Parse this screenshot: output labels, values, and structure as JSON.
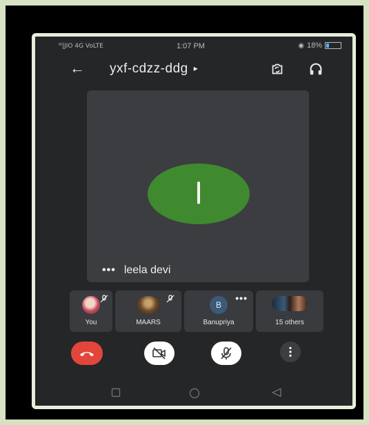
{
  "status": {
    "carrier": "ᴵᴵᴵ|JIO 4G VoLTE",
    "time": "1:07 PM",
    "battery": "18%"
  },
  "header": {
    "back_icon": "arrow-left-icon",
    "meeting_code": "yxf-cdzz-ddg",
    "meeting_caret": "▸",
    "switch_camera_icon": "switch-camera-icon",
    "audio_icon": "headphones-icon"
  },
  "main_tile": {
    "avatar_initial": "l",
    "avatar_color": "#3f8a2e",
    "more": "•••",
    "name": "leela devi"
  },
  "participants": [
    {
      "label": "You",
      "muted": true
    },
    {
      "label": "MAARS",
      "muted": true
    },
    {
      "label": "Banupriya",
      "initial": "B",
      "more": "•••"
    },
    {
      "label": "15 others"
    }
  ],
  "controls": {
    "end_call_color": "#e2463b",
    "end_call_icon": "phone-hangup-icon",
    "camera_icon": "camera-off-icon",
    "mic_icon": "mic-off-icon",
    "more_icon": "more-vertical-icon"
  },
  "navbar": {
    "recent_icon": "square-icon",
    "home_icon": "circle-icon",
    "back_icon": "triangle-back-icon"
  }
}
